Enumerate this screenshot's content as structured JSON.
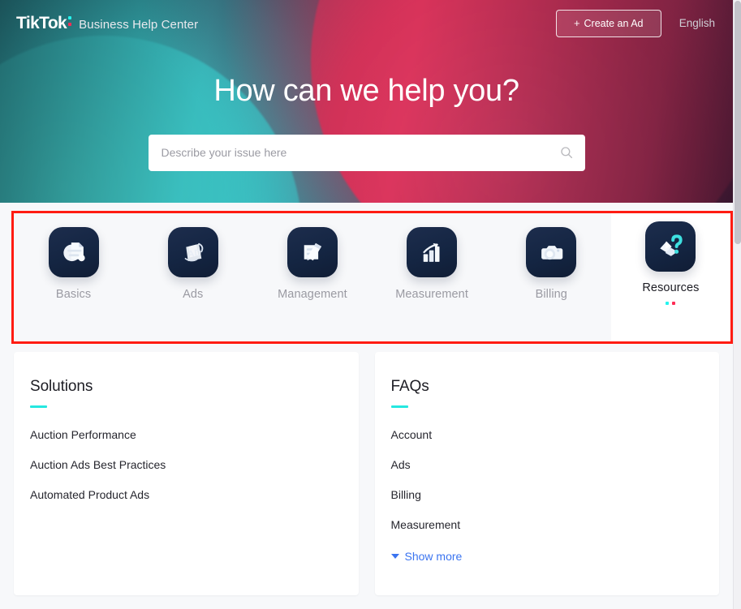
{
  "header": {
    "brand_primary": "TikTok",
    "brand_secondary": "Business Help Center",
    "cta_label": "Create an Ad",
    "cta_plus": "+",
    "language": "English"
  },
  "hero": {
    "title": "How can we help you?",
    "search_placeholder": "Describe your issue here",
    "search_value": ""
  },
  "categories": [
    {
      "label": "Basics",
      "icon": "document-icon",
      "active": false
    },
    {
      "label": "Ads",
      "icon": "ads-icon",
      "active": false
    },
    {
      "label": "Management",
      "icon": "edit-doc-icon",
      "active": false
    },
    {
      "label": "Measurement",
      "icon": "bar-chart-icon",
      "active": false
    },
    {
      "label": "Billing",
      "icon": "camera-icon",
      "active": false
    },
    {
      "label": "Resources",
      "icon": "question-icon",
      "active": true
    }
  ],
  "panels": [
    {
      "title": "Solutions",
      "items": [
        "Auction Performance",
        "Auction Ads Best Practices",
        "Automated Product Ads"
      ],
      "show_more": null
    },
    {
      "title": "FAQs",
      "items": [
        "Account",
        "Ads",
        "Billing",
        "Measurement"
      ],
      "show_more": "Show more"
    }
  ],
  "colors": {
    "accent_teal": "#25f4ee",
    "accent_pink": "#fe2c55",
    "link_blue": "#3b74f0",
    "highlight_red": "#ff1c12",
    "panel_rule": "#25e8e0"
  }
}
